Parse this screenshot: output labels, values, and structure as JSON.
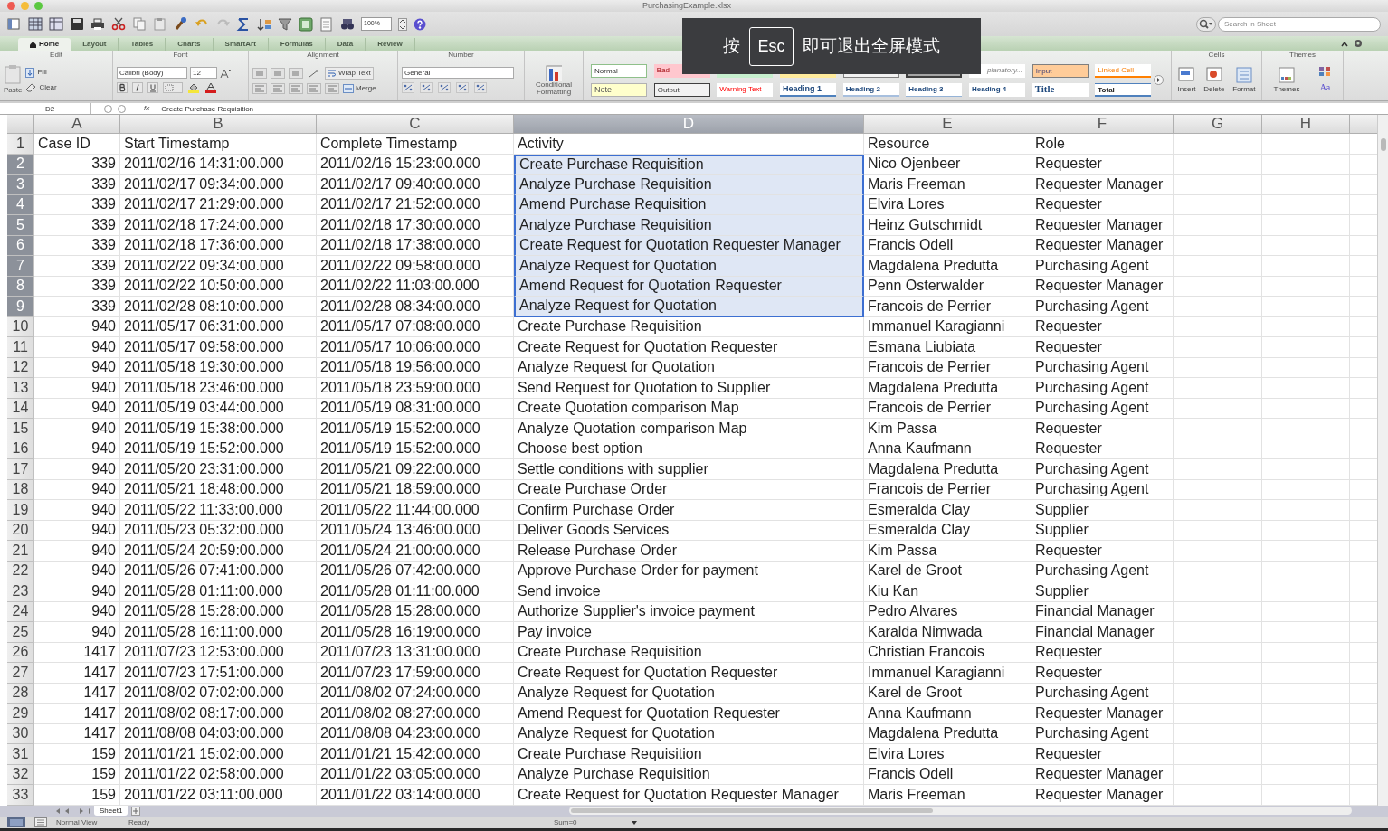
{
  "window": {
    "title": "PurchasingExample.xlsx"
  },
  "toolbar": {
    "zoom": "100%",
    "search_placeholder": "Search in Sheet"
  },
  "ribbon_tabs": [
    {
      "label": "Home",
      "selected": true
    },
    {
      "label": "Layout",
      "selected": false
    },
    {
      "label": "Tables",
      "selected": false
    },
    {
      "label": "Charts",
      "selected": false
    },
    {
      "label": "SmartArt",
      "selected": false
    },
    {
      "label": "Formulas",
      "selected": false
    },
    {
      "label": "Data",
      "selected": false
    },
    {
      "label": "Review",
      "selected": false
    }
  ],
  "ribbon": {
    "group_labels": [
      "Edit",
      "Font",
      "Alignment",
      "Number",
      "Cells",
      "Themes"
    ],
    "paste": "Paste",
    "fill": "Fill",
    "clear": "Clear",
    "font_name": "Calibri (Body)",
    "font_size": "12",
    "wrap_text": "Wrap Text",
    "merge": "Merge",
    "number_format": "General",
    "conditional_formatting": "Conditional Formatting",
    "styles_top": [
      {
        "label": "Normal",
        "kind": "normal"
      },
      {
        "label": "Bad",
        "kind": "bad"
      },
      {
        "kind": "good"
      },
      {
        "kind": "neutral"
      },
      {
        "kind": "calculation"
      },
      {
        "kind": "check"
      },
      {
        "label": "planatory...",
        "kind": "explanatory"
      },
      {
        "label": "Input",
        "kind": "input"
      },
      {
        "label": "Linked Cell",
        "kind": "linked"
      }
    ],
    "styles_bottom": [
      {
        "label": "Note",
        "kind": "note"
      },
      {
        "label": "Output",
        "kind": "output"
      },
      {
        "label": "Warning Text",
        "kind": "warning"
      },
      {
        "label": "Heading 1",
        "kind": "heading1"
      },
      {
        "label": "Heading 2",
        "kind": "heading2"
      },
      {
        "label": "Heading 3",
        "kind": "heading3"
      },
      {
        "label": "Heading 4",
        "kind": "heading4"
      },
      {
        "label": "Title",
        "kind": "title"
      },
      {
        "label": "Total",
        "kind": "total"
      }
    ],
    "cells_buttons": [
      "Insert",
      "Delete",
      "Format"
    ],
    "themes_button": "Themes",
    "fonts_button": "Aa"
  },
  "formula_bar": {
    "name_box": "D2",
    "fx": "fx",
    "formula": "Create Purchase Requisition"
  },
  "fullscreen_hint": {
    "before": "按",
    "key": "Esc",
    "after": "即可退出全屏模式"
  },
  "columns": [
    {
      "letter": "A",
      "selected": false
    },
    {
      "letter": "B",
      "selected": false
    },
    {
      "letter": "C",
      "selected": false
    },
    {
      "letter": "D",
      "selected": true
    },
    {
      "letter": "E",
      "selected": false
    },
    {
      "letter": "F",
      "selected": false
    },
    {
      "letter": "G",
      "selected": false
    },
    {
      "letter": "H",
      "selected": false
    }
  ],
  "rows": [
    {
      "number": "1",
      "selected": false,
      "cells": [
        "Case ID",
        "Start Timestamp",
        "Complete Timestamp",
        "Activity",
        "Resource",
        "Role"
      ]
    },
    {
      "number": "2",
      "selected": true,
      "cells": [
        "339",
        "2011/02/16 14:31:00.000",
        "2011/02/16 15:23:00.000",
        "Create Purchase Requisition",
        "Nico Ojenbeer",
        "Requester"
      ]
    },
    {
      "number": "3",
      "selected": true,
      "cells": [
        "339",
        "2011/02/17 09:34:00.000",
        "2011/02/17 09:40:00.000",
        "Analyze Purchase Requisition",
        "Maris Freeman",
        "Requester Manager"
      ]
    },
    {
      "number": "4",
      "selected": true,
      "cells": [
        "339",
        "2011/02/17 21:29:00.000",
        "2011/02/17 21:52:00.000",
        "Amend Purchase Requisition",
        "Elvira Lores",
        "Requester"
      ]
    },
    {
      "number": "5",
      "selected": true,
      "cells": [
        "339",
        "2011/02/18 17:24:00.000",
        "2011/02/18 17:30:00.000",
        "Analyze Purchase Requisition",
        "Heinz Gutschmidt",
        "Requester Manager"
      ]
    },
    {
      "number": "6",
      "selected": true,
      "cells": [
        "339",
        "2011/02/18 17:36:00.000",
        "2011/02/18 17:38:00.000",
        "Create Request for Quotation Requester Manager",
        "Francis Odell",
        "Requester Manager"
      ]
    },
    {
      "number": "7",
      "selected": true,
      "cells": [
        "339",
        "2011/02/22 09:34:00.000",
        "2011/02/22 09:58:00.000",
        "Analyze Request for Quotation",
        "Magdalena Predutta",
        "Purchasing Agent"
      ]
    },
    {
      "number": "8",
      "selected": true,
      "cells": [
        "339",
        "2011/02/22 10:50:00.000",
        "2011/02/22 11:03:00.000",
        "Amend Request for Quotation Requester",
        "Penn Osterwalder",
        "Requester Manager"
      ]
    },
    {
      "number": "9",
      "selected": true,
      "cells": [
        "339",
        "2011/02/28 08:10:00.000",
        "2011/02/28 08:34:00.000",
        "Analyze Request for Quotation",
        "Francois de Perrier",
        "Purchasing Agent"
      ]
    },
    {
      "number": "10",
      "selected": false,
      "cells": [
        "940",
        "2011/05/17 06:31:00.000",
        "2011/05/17 07:08:00.000",
        "Create Purchase Requisition",
        "Immanuel Karagianni",
        "Requester"
      ]
    },
    {
      "number": "11",
      "selected": false,
      "cells": [
        "940",
        "2011/05/17 09:58:00.000",
        "2011/05/17 10:06:00.000",
        "Create Request for Quotation Requester",
        "Esmana Liubiata",
        "Requester"
      ]
    },
    {
      "number": "12",
      "selected": false,
      "cells": [
        "940",
        "2011/05/18 19:30:00.000",
        "2011/05/18 19:56:00.000",
        "Analyze Request for Quotation",
        "Francois de Perrier",
        "Purchasing Agent"
      ]
    },
    {
      "number": "13",
      "selected": false,
      "cells": [
        "940",
        "2011/05/18 23:46:00.000",
        "2011/05/18 23:59:00.000",
        "Send Request for Quotation to Supplier",
        "Magdalena Predutta",
        "Purchasing Agent"
      ]
    },
    {
      "number": "14",
      "selected": false,
      "cells": [
        "940",
        "2011/05/19 03:44:00.000",
        "2011/05/19 08:31:00.000",
        "Create Quotation comparison Map",
        "Francois de Perrier",
        "Purchasing Agent"
      ]
    },
    {
      "number": "15",
      "selected": false,
      "cells": [
        "940",
        "2011/05/19 15:38:00.000",
        "2011/05/19 15:52:00.000",
        "Analyze Quotation comparison Map",
        "Kim Passa",
        "Requester"
      ]
    },
    {
      "number": "16",
      "selected": false,
      "cells": [
        "940",
        "2011/05/19 15:52:00.000",
        "2011/05/19 15:52:00.000",
        "Choose best option",
        "Anna Kaufmann",
        "Requester"
      ]
    },
    {
      "number": "17",
      "selected": false,
      "cells": [
        "940",
        "2011/05/20 23:31:00.000",
        "2011/05/21 09:22:00.000",
        "Settle conditions with supplier",
        "Magdalena Predutta",
        "Purchasing Agent"
      ]
    },
    {
      "number": "18",
      "selected": false,
      "cells": [
        "940",
        "2011/05/21 18:48:00.000",
        "2011/05/21 18:59:00.000",
        "Create Purchase Order",
        "Francois de Perrier",
        "Purchasing Agent"
      ]
    },
    {
      "number": "19",
      "selected": false,
      "cells": [
        "940",
        "2011/05/22 11:33:00.000",
        "2011/05/22 11:44:00.000",
        "Confirm Purchase Order",
        "Esmeralda Clay",
        "Supplier"
      ]
    },
    {
      "number": "20",
      "selected": false,
      "cells": [
        "940",
        "2011/05/23 05:32:00.000",
        "2011/05/24 13:46:00.000",
        "Deliver Goods Services",
        "Esmeralda Clay",
        "Supplier"
      ]
    },
    {
      "number": "21",
      "selected": false,
      "cells": [
        "940",
        "2011/05/24 20:59:00.000",
        "2011/05/24 21:00:00.000",
        "Release Purchase Order",
        "Kim Passa",
        "Requester"
      ]
    },
    {
      "number": "22",
      "selected": false,
      "cells": [
        "940",
        "2011/05/26 07:41:00.000",
        "2011/05/26 07:42:00.000",
        "Approve Purchase Order for payment",
        "Karel de Groot",
        "Purchasing Agent"
      ]
    },
    {
      "number": "23",
      "selected": false,
      "cells": [
        "940",
        "2011/05/28 01:11:00.000",
        "2011/05/28 01:11:00.000",
        "Send invoice",
        "Kiu Kan",
        "Supplier"
      ]
    },
    {
      "number": "24",
      "selected": false,
      "cells": [
        "940",
        "2011/05/28 15:28:00.000",
        "2011/05/28 15:28:00.000",
        "Authorize Supplier's invoice payment",
        "Pedro Alvares",
        "Financial Manager"
      ]
    },
    {
      "number": "25",
      "selected": false,
      "cells": [
        "940",
        "2011/05/28 16:11:00.000",
        "2011/05/28 16:19:00.000",
        "Pay invoice",
        "Karalda Nimwada",
        "Financial Manager"
      ]
    },
    {
      "number": "26",
      "selected": false,
      "cells": [
        "1417",
        "2011/07/23 12:53:00.000",
        "2011/07/23 13:31:00.000",
        "Create Purchase Requisition",
        "Christian Francois",
        "Requester"
      ]
    },
    {
      "number": "27",
      "selected": false,
      "cells": [
        "1417",
        "2011/07/23 17:51:00.000",
        "2011/07/23 17:59:00.000",
        "Create Request for Quotation Requester",
        "Immanuel Karagianni",
        "Requester"
      ]
    },
    {
      "number": "28",
      "selected": false,
      "cells": [
        "1417",
        "2011/08/02 07:02:00.000",
        "2011/08/02 07:24:00.000",
        "Analyze Request for Quotation",
        "Karel de Groot",
        "Purchasing Agent"
      ]
    },
    {
      "number": "29",
      "selected": false,
      "cells": [
        "1417",
        "2011/08/02 08:17:00.000",
        "2011/08/02 08:27:00.000",
        "Amend Request for Quotation Requester",
        "Anna Kaufmann",
        "Requester Manager"
      ]
    },
    {
      "number": "30",
      "selected": false,
      "cells": [
        "1417",
        "2011/08/08 04:03:00.000",
        "2011/08/08 04:23:00.000",
        "Analyze Request for Quotation",
        "Magdalena Predutta",
        "Purchasing Agent"
      ]
    },
    {
      "number": "31",
      "selected": false,
      "cells": [
        "159",
        "2011/01/21 15:02:00.000",
        "2011/01/21 15:42:00.000",
        "Create Purchase Requisition",
        "Elvira Lores",
        "Requester"
      ]
    },
    {
      "number": "32",
      "selected": false,
      "cells": [
        "159",
        "2011/01/22 02:58:00.000",
        "2011/01/22 03:05:00.000",
        "Analyze Purchase Requisition",
        "Francis Odell",
        "Requester Manager"
      ]
    },
    {
      "number": "33",
      "selected": false,
      "cells": [
        "159",
        "2011/01/22 03:11:00.000",
        "2011/01/22 03:14:00.000",
        "Create Request for Quotation Requester Manager",
        "Maris Freeman",
        "Requester Manager"
      ]
    }
  ],
  "sheet_tabs": [
    {
      "label": "Sheet1",
      "selected": true
    }
  ],
  "status_bar": {
    "view": "Normal View",
    "state": "Ready",
    "sum": "Sum=0"
  }
}
